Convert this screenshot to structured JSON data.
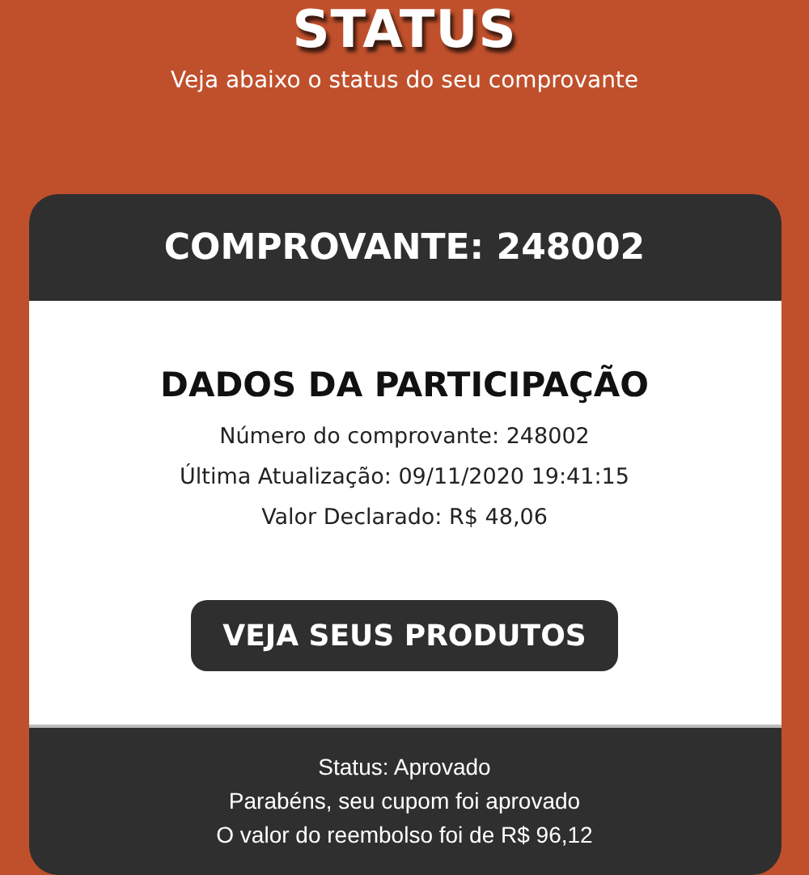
{
  "header": {
    "title": "STATUS",
    "subtitle": "Veja abaixo o status do seu comprovante"
  },
  "card": {
    "title": "COMPROVANTE: 248002",
    "section_title": "DADOS DA PARTICIPAÇÃO",
    "details": [
      "Número do comprovante: 248002",
      "Última Atualização: 09/11/2020 19:41:15",
      "Valor Declarado: R$ 48,06"
    ],
    "button": "VEJA SEUS PRODUTOS",
    "status_lines": [
      "Status: Aprovado",
      "Parabéns, seu cupom foi aprovado",
      "O valor do reembolso foi de R$ 96,12"
    ]
  }
}
